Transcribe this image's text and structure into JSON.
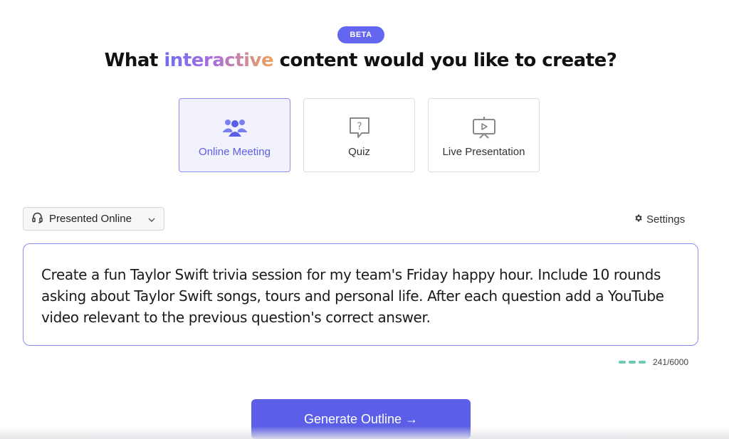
{
  "badge": "BETA",
  "headline": {
    "before": "What ",
    "highlight": "interactive",
    "after": " content would you like to create?"
  },
  "content_types": [
    {
      "label": "Online Meeting",
      "icon": "people-group-icon",
      "selected": true
    },
    {
      "label": "Quiz",
      "icon": "question-bubble-icon",
      "selected": false
    },
    {
      "label": "Live Presentation",
      "icon": "presentation-screen-icon",
      "selected": false
    }
  ],
  "mode": {
    "label": "Presented Online",
    "icon": "headset-icon"
  },
  "settings_label": "Settings",
  "prompt_text": "Create a fun Taylor Swift trivia session for my team's Friday happy hour. Include 10 rounds asking about Taylor Swift songs, tours and personal life. After each question add a YouTube video relevant to the previous question's correct answer.",
  "char_count": "241/6000",
  "generate_label": "Generate Outline →",
  "colors": {
    "accent": "#5b5ee6",
    "counter": "#6ec9b3"
  }
}
